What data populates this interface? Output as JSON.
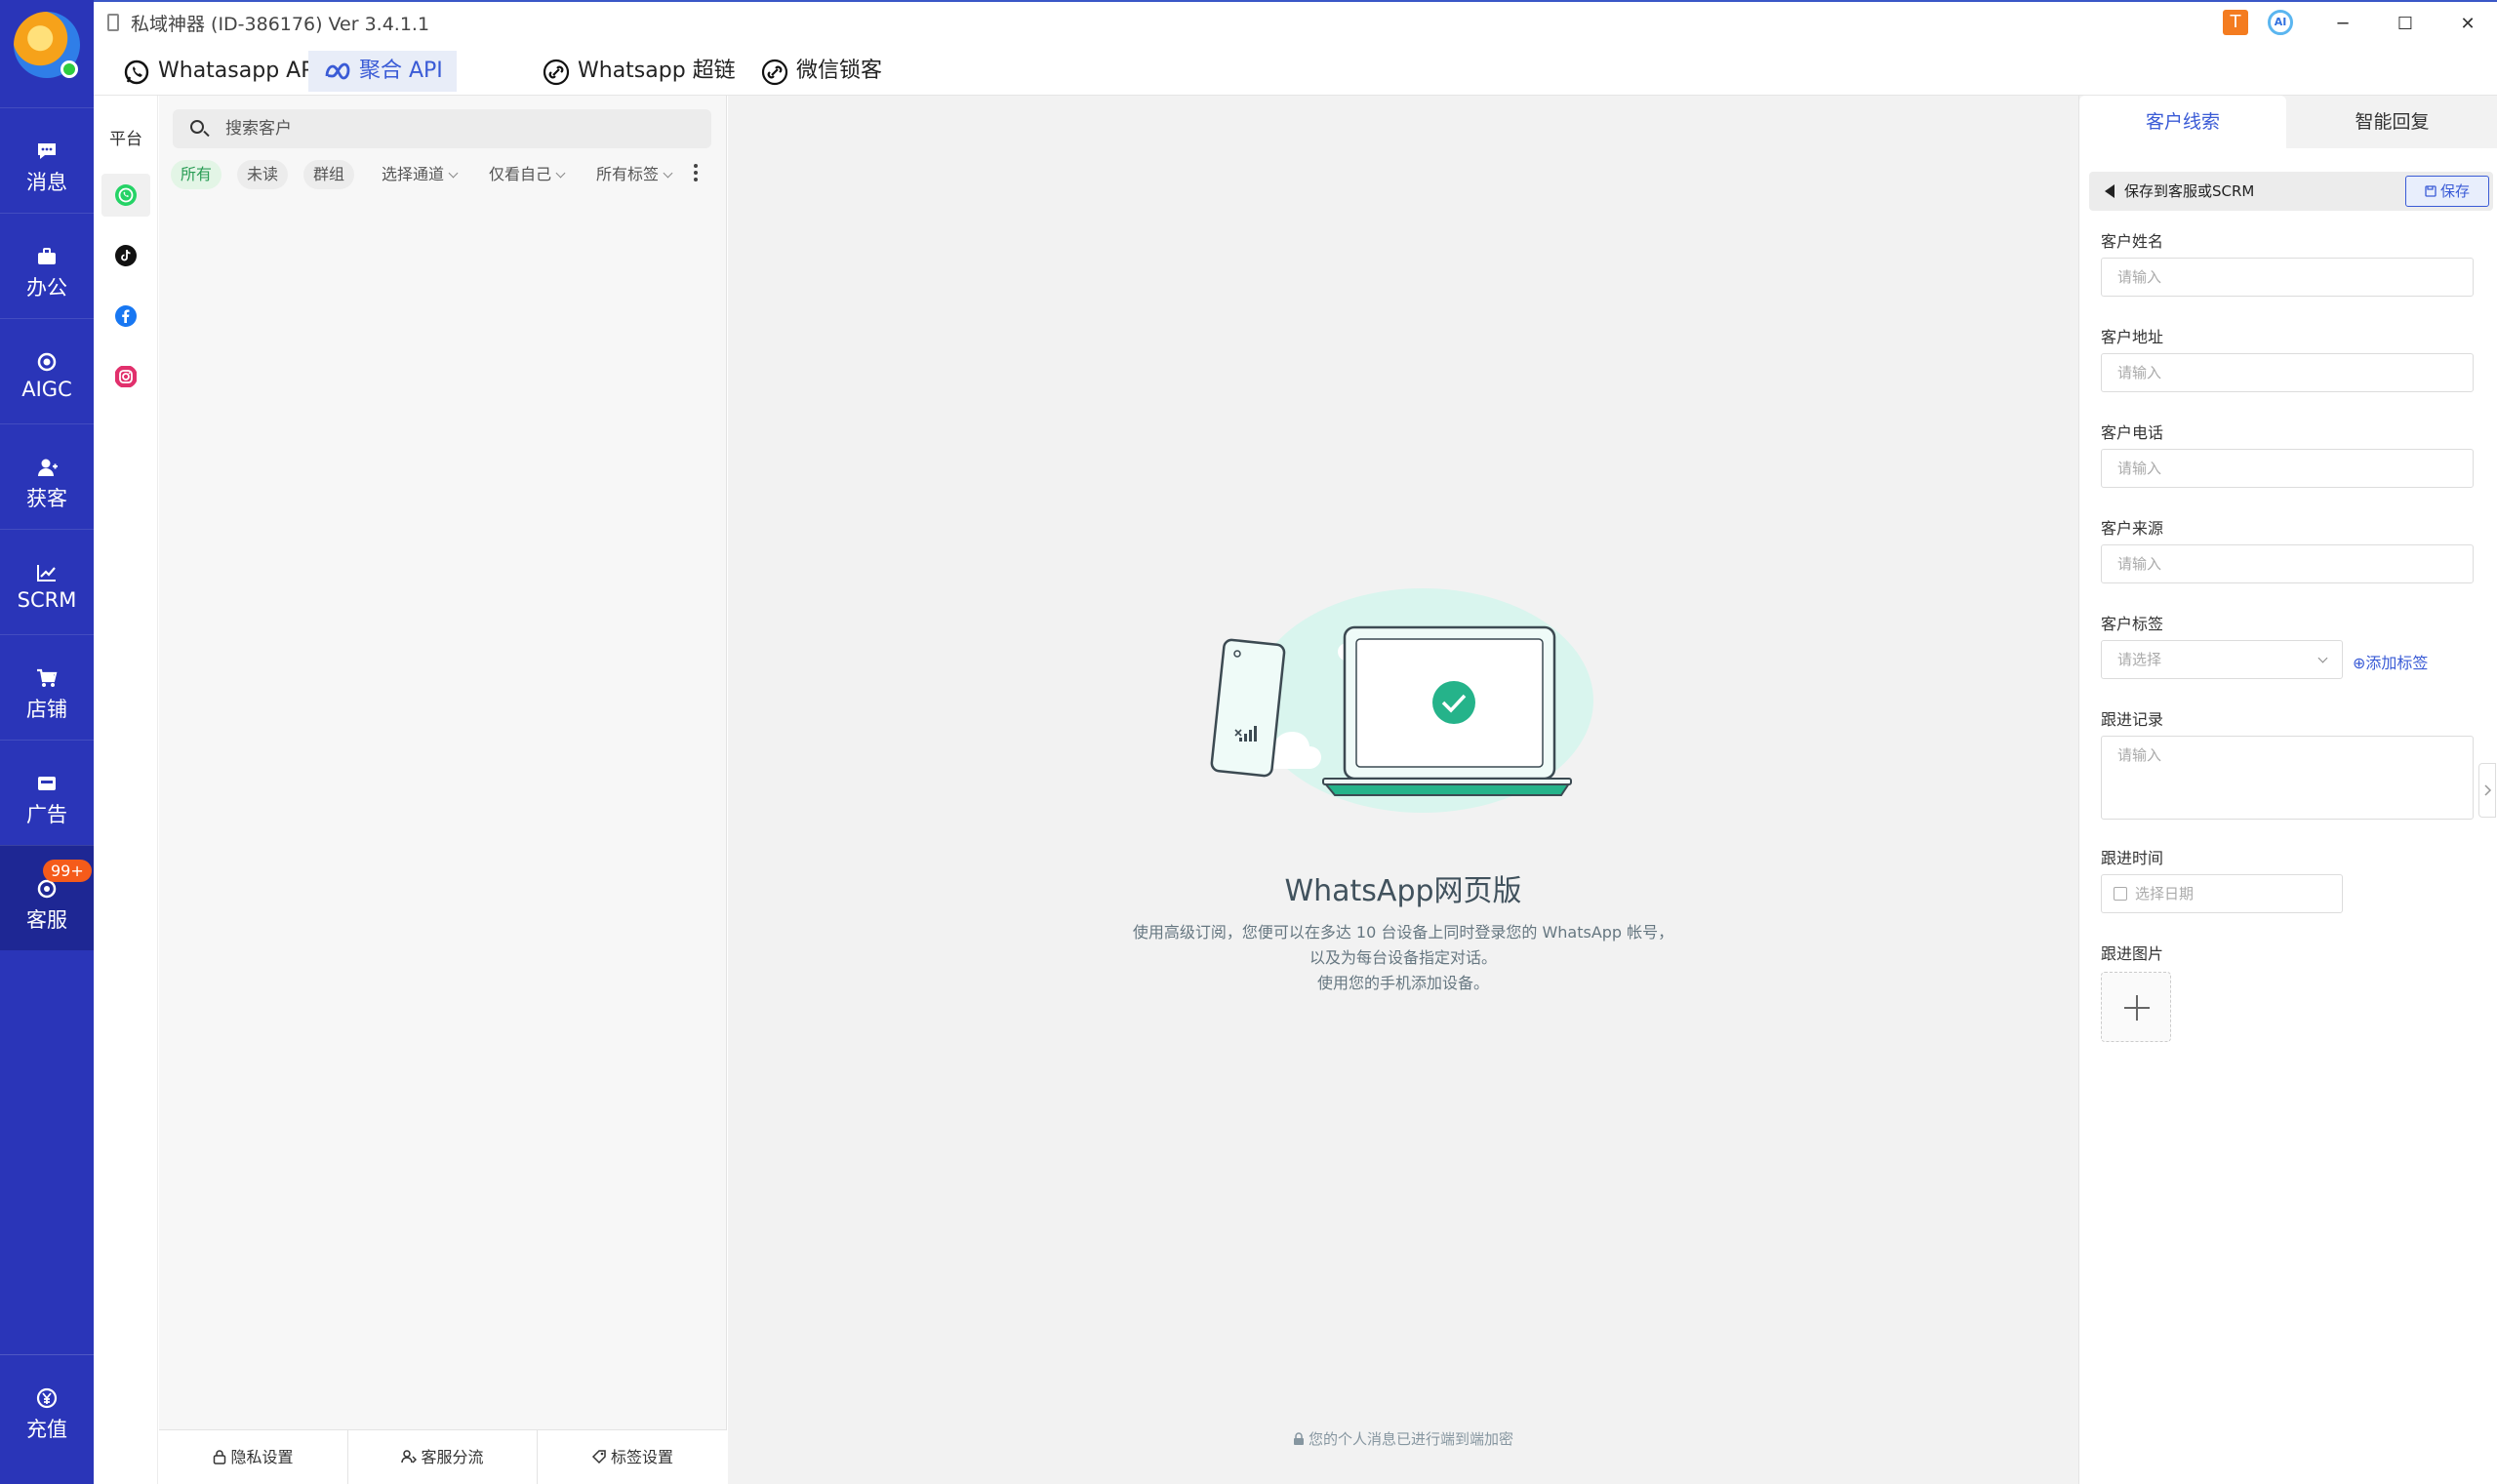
{
  "titlebar": {
    "title": "私域神器 (ID-386176)  Ver 3.4.1.1",
    "tool1": "T",
    "tool2": "AI",
    "minimize": "─",
    "maximize": "☐",
    "close": "✕"
  },
  "nav": {
    "items": [
      {
        "label": "消息",
        "icon": "chat-bubble-icon"
      },
      {
        "label": "办公",
        "icon": "briefcase-icon"
      },
      {
        "label": "AIGC",
        "icon": "ai-brain-icon"
      },
      {
        "label": "获客",
        "icon": "user-plus-icon"
      },
      {
        "label": "SCRM",
        "icon": "line-chart-icon"
      },
      {
        "label": "店铺",
        "icon": "shopping-cart-icon"
      },
      {
        "label": "广告",
        "icon": "ad-icon"
      },
      {
        "label": "客服",
        "icon": "headset-icon",
        "badge": "99+",
        "active": true
      }
    ],
    "recharge": {
      "label": "充值",
      "icon": "yen-icon"
    }
  },
  "tabs": [
    {
      "label": "Whatasapp APP",
      "icon": "whatsapp-icon"
    },
    {
      "label": "聚合 API",
      "icon": "meta-icon",
      "active": true
    },
    {
      "label": "Whatsapp 超链",
      "icon": "link-icon"
    },
    {
      "label": "微信锁客",
      "icon": "link-icon"
    }
  ],
  "platforms": {
    "title": "平台",
    "items": [
      "whatsapp-icon",
      "tiktok-icon",
      "facebook-icon",
      "instagram-icon"
    ]
  },
  "list": {
    "search_placeholder": "搜索客户",
    "filters": [
      "所有",
      "未读",
      "群组"
    ],
    "dropdowns": [
      "选择通道",
      "仅看自己",
      "所有标签"
    ],
    "footer": [
      "隐私设置",
      "客服分流",
      "标签设置"
    ]
  },
  "center": {
    "title": "WhatsApp网页版",
    "desc1": "使用高级订阅，您便可以在多达 10 台设备上同时登录您的 WhatsApp 帐号，",
    "desc2": "以及为每台设备指定对话。",
    "desc3": "使用您的手机添加设备。",
    "encryption": "您的个人消息已进行端到端加密"
  },
  "right": {
    "tabs": [
      "客户线索",
      "智能回复"
    ],
    "save_bar": "保存到客服或SCRM",
    "save_button": "保存",
    "fields": [
      {
        "label": "客户姓名",
        "placeholder": "请输入"
      },
      {
        "label": "客户地址",
        "placeholder": "请输入"
      },
      {
        "label": "客户电话",
        "placeholder": "请输入"
      },
      {
        "label": "客户来源",
        "placeholder": "请输入"
      }
    ],
    "tag_label": "客户标签",
    "tag_placeholder": "请选择",
    "add_tag": "⊕添加标签",
    "notes_label": "跟进记录",
    "notes_placeholder": "请输入",
    "time_label": "跟进时间",
    "date_placeholder": "选择日期",
    "image_label": "跟进图片"
  },
  "colors": {
    "nav_bg": "#2a35b8",
    "accent": "#3a5bd6",
    "whatsapp_green": "#25d366",
    "badge": "#f55b1a"
  }
}
